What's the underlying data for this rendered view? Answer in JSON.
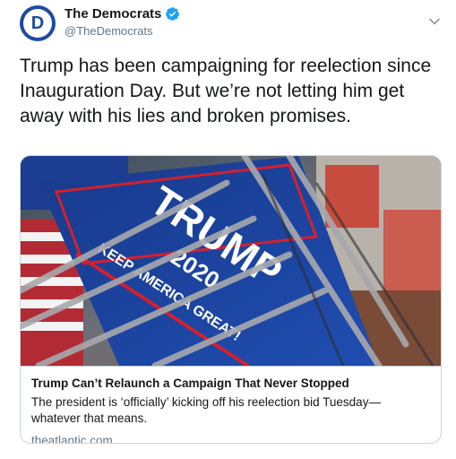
{
  "author": {
    "avatar_letter": "D",
    "display_name": "The Democrats",
    "handle": "@TheDemocrats",
    "verified": true
  },
  "icons": {
    "verified": "verified-badge-icon",
    "menu": "chevron-down-icon"
  },
  "tweet": {
    "text": "Trump has been campaigning for reelection since Inauguration Day. But we’re not letting him get away with his lies and broken promises."
  },
  "card": {
    "image_banner_lines": [
      "TRUMP",
      "2020",
      "KEEP AMERICA GREAT!"
    ],
    "title": "Trump Can’t Relaunch a Campaign That Never Stopped",
    "description": "The president is ‘officially’ kicking off his reelection bid Tuesday—whatever that means.",
    "domain": "theatlantic.com"
  },
  "colors": {
    "brand_blue": "#1c4ba0",
    "verified_blue": "#1da1f2",
    "banner_blue": "#1c3d91",
    "banner_red": "#d4202c",
    "text_dark": "#14171a",
    "text_muted": "#657786",
    "border": "#ccd6dd"
  }
}
